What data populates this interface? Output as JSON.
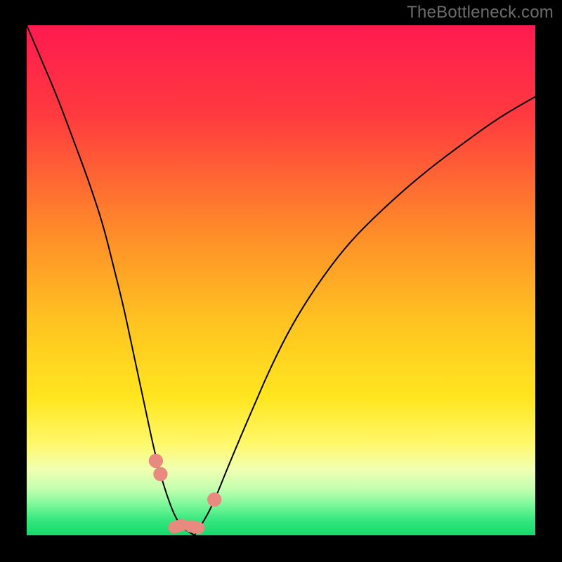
{
  "watermark": "TheBottleneck.com",
  "chart_data": {
    "type": "line",
    "title": "",
    "xlabel": "",
    "ylabel": "",
    "xlim": [
      0,
      100
    ],
    "ylim": [
      0,
      100
    ],
    "gradient_stops": [
      {
        "offset": 0,
        "color": "#ff1a4f"
      },
      {
        "offset": 18,
        "color": "#ff3b3f"
      },
      {
        "offset": 40,
        "color": "#ff8a2a"
      },
      {
        "offset": 58,
        "color": "#ffc321"
      },
      {
        "offset": 73,
        "color": "#ffe61f"
      },
      {
        "offset": 82,
        "color": "#fff86a"
      },
      {
        "offset": 87,
        "color": "#f1ffb0"
      },
      {
        "offset": 91,
        "color": "#c3ffb0"
      },
      {
        "offset": 94,
        "color": "#7cf79a"
      },
      {
        "offset": 97,
        "color": "#36e77f"
      },
      {
        "offset": 100,
        "color": "#17d96b"
      }
    ],
    "series": [
      {
        "name": "left-curve",
        "x": [
          0,
          3,
          6,
          9,
          12,
          15,
          17,
          19,
          20.5,
          22,
          23.5,
          25,
          26.3,
          27.5,
          29,
          30.5,
          33
        ],
        "y": [
          100,
          93,
          86,
          78,
          70,
          61,
          53,
          45,
          38,
          31,
          24,
          17,
          12,
          8,
          4,
          1.5,
          0
        ]
      },
      {
        "name": "right-curve",
        "x": [
          33,
          35,
          37,
          39,
          41.5,
          44.5,
          48,
          52,
          57,
          63,
          70,
          78,
          86,
          93,
          100
        ],
        "y": [
          0,
          3,
          7,
          12,
          18,
          25,
          33,
          41,
          49,
          57,
          64,
          71,
          77,
          82,
          86
        ]
      }
    ],
    "markers": [
      {
        "shape": "circle",
        "cx": 26.3,
        "cy": 12.0,
        "r": 1.4
      },
      {
        "shape": "circle",
        "cx": 25.4,
        "cy": 14.6,
        "r": 1.4
      },
      {
        "shape": "capsule",
        "cx": 29.8,
        "cy": 1.8,
        "w": 4.0,
        "h": 2.4,
        "rot": -18
      },
      {
        "shape": "capsule",
        "cx": 33.0,
        "cy": 1.6,
        "w": 4.0,
        "h": 2.4,
        "rot": 12
      },
      {
        "shape": "circle",
        "cx": 36.9,
        "cy": 7.0,
        "r": 1.4
      }
    ],
    "marker_color": "#e88a80",
    "curve_color": "#000000"
  }
}
